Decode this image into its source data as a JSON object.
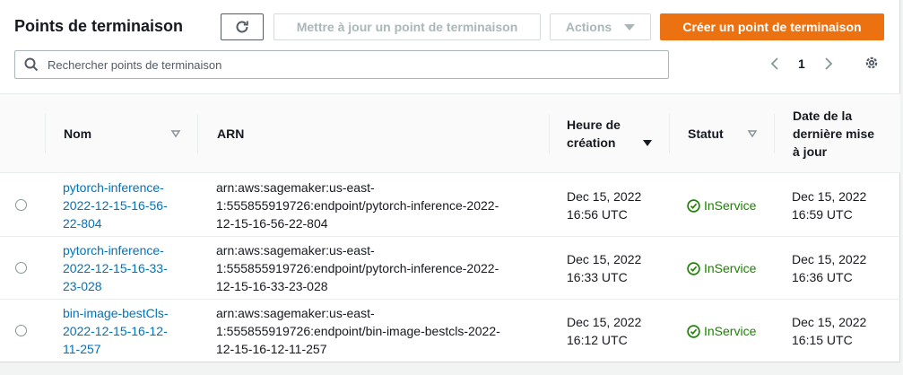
{
  "header": {
    "title": "Points de terminaison",
    "update_label": "Mettre à jour un point de terminaison",
    "actions_label": "Actions",
    "create_label": "Créer un point de terminaison"
  },
  "search": {
    "placeholder": "Rechercher points de terminaison"
  },
  "pagination": {
    "current_page": "1"
  },
  "columns": {
    "name": "Nom",
    "arn": "ARN",
    "created_line1": "Heure de",
    "created_line2": "création",
    "status": "Statut",
    "updated_line1": "Date de la",
    "updated_line2": "dernière mise",
    "updated_line3": "à jour"
  },
  "rows": [
    {
      "name_lines": [
        "pytorch-inference-",
        "2022-12-15-16-56-",
        "22-804"
      ],
      "arn_lines": [
        "arn:aws:sagemaker:us-east-",
        "1:555855919726:endpoint/pytorch-inference-2022-",
        "12-15-16-56-22-804"
      ],
      "created_lines": [
        "Dec 15, 2022",
        "16:56 UTC"
      ],
      "status": "InService",
      "updated_lines": [
        "Dec 15, 2022",
        "16:59 UTC"
      ]
    },
    {
      "name_lines": [
        "pytorch-inference-",
        "2022-12-15-16-33-",
        "23-028"
      ],
      "arn_lines": [
        "arn:aws:sagemaker:us-east-",
        "1:555855919726:endpoint/pytorch-inference-2022-",
        "12-15-16-33-23-028"
      ],
      "created_lines": [
        "Dec 15, 2022",
        "16:33 UTC"
      ],
      "status": "InService",
      "updated_lines": [
        "Dec 15, 2022",
        "16:36 UTC"
      ]
    },
    {
      "name_lines": [
        "bin-image-bestCls-",
        "2022-12-15-16-12-",
        "11-257"
      ],
      "arn_lines": [
        "arn:aws:sagemaker:us-east-",
        "1:555855919726:endpoint/bin-image-bestcls-2022-",
        "12-15-16-12-11-257"
      ],
      "created_lines": [
        "Dec 15, 2022",
        "16:12 UTC"
      ],
      "status": "InService",
      "updated_lines": [
        "Dec 15, 2022",
        "16:15 UTC"
      ]
    }
  ],
  "colors": {
    "accent": "#ec7211",
    "link": "#0073bb",
    "success": "#1d8102"
  },
  "icons": {
    "refresh": "refresh-icon",
    "search": "search-icon",
    "settings": "gear-icon",
    "status": "check-circle-icon"
  }
}
